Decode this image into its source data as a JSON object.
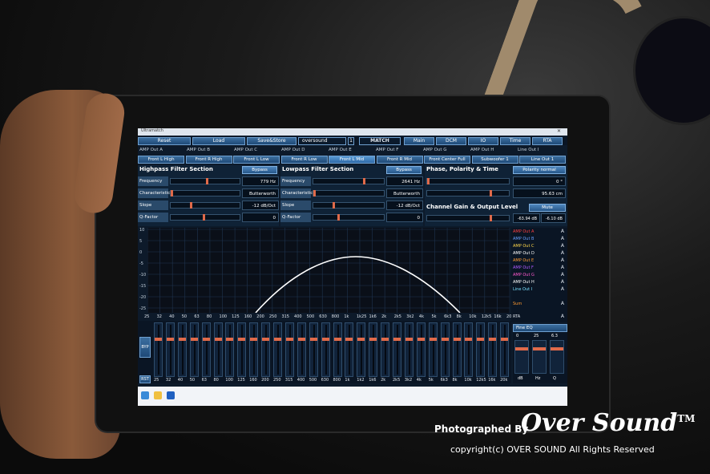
{
  "window": {
    "title": "Ultramatch",
    "close_glyph": "✕"
  },
  "toolbar": {
    "reset": "Reset",
    "load": "Load",
    "save_store": "Save&Store",
    "preset_name": "oversound",
    "preset_index": "1",
    "logo": "MATCH",
    "main": "Main",
    "dcm": "DCM",
    "io": "IO",
    "time": "Time",
    "rta": "RTA"
  },
  "amp_outputs": [
    "AMP Out A",
    "AMP Out B",
    "AMP Out C",
    "AMP Out D",
    "AMP Out E",
    "AMP Out F",
    "AMP Out G",
    "AMP Out H",
    "Line Out I"
  ],
  "channels": [
    "Front L High",
    "Front R High",
    "Front L Low",
    "Front R Low",
    "Front L Mid",
    "Front R Mid",
    "Front Center Full",
    "Subwoofer 1",
    "Line Out 1"
  ],
  "highpass": {
    "title": "Highpass Filter Section",
    "bypass": "Bypass",
    "frequency_label": "Frequency",
    "frequency": "779 Hz",
    "characteristic_label": "Characteristic",
    "characteristic": "Butterworth",
    "slope_label": "Slope",
    "slope": "-12 dB/Oct",
    "qfactor_label": "Q-Factor",
    "qfactor": "0"
  },
  "lowpass": {
    "title": "Lowpass Filter Section",
    "bypass": "Bypass",
    "frequency_label": "Frequency",
    "frequency": "2641 Hz",
    "characteristic_label": "Characteristic",
    "characteristic": "Butterworth",
    "slope_label": "Slope",
    "slope": "-12 dB/Oct",
    "qfactor_label": "Q-Factor",
    "qfactor": "0"
  },
  "phase": {
    "title": "Phase, Polarity & Time",
    "polarity": "Polarity normal",
    "phase_value": "0 °",
    "distance": "95.63 cm"
  },
  "gain": {
    "title": "Channel Gain & Output Level",
    "mute": "Mute",
    "level": "-63.94 dB",
    "gain_value": "-6.10 dB"
  },
  "graph": {
    "y_ticks": [
      "10",
      "5",
      "0",
      "-5",
      "-10",
      "-15",
      "-20",
      "-25"
    ],
    "x_ticks": [
      "25",
      "32",
      "40",
      "50",
      "63",
      "80",
      "100",
      "125",
      "160",
      "200",
      "250",
      "315",
      "400",
      "500",
      "630",
      "800",
      "1k",
      "1k25",
      "1k6",
      "2k",
      "2k5",
      "3k2",
      "4k",
      "5k",
      "6k3",
      "8k",
      "10k",
      "12k5",
      "16k",
      "20k"
    ],
    "curve_color": "#ffffff"
  },
  "output_list": [
    {
      "name": "AMP Out A",
      "color": "#ff4040"
    },
    {
      "name": "AMP Out B",
      "color": "#6aa0ff"
    },
    {
      "name": "AMP Out C",
      "color": "#ffd84a"
    },
    {
      "name": "AMP Out D",
      "color": "#ffffff"
    },
    {
      "name": "AMP Out E",
      "color": "#ff9a30"
    },
    {
      "name": "AMP Out F",
      "color": "#b05aff"
    },
    {
      "name": "AMP Out G",
      "color": "#ff5ad0"
    },
    {
      "name": "AMP Out H",
      "color": "#ffffff"
    },
    {
      "name": "Line Out I",
      "color": "#7ae0ff"
    }
  ],
  "output_list_sum": "Sum",
  "output_list_rta": "RTA",
  "output_list_a": "A",
  "faders": {
    "bypass": "BYP",
    "reset": "RST",
    "bands": [
      "25",
      "32",
      "40",
      "50",
      "63",
      "80",
      "100",
      "125",
      "160",
      "200",
      "250",
      "315",
      "400",
      "500",
      "630",
      "800",
      "1k",
      "1k2",
      "1k6",
      "2k",
      "2k5",
      "3k2",
      "4k",
      "5k",
      "6k3",
      "8k",
      "10k",
      "12k5",
      "16k",
      "20k"
    ]
  },
  "fine_eq": {
    "title": "Fine EQ",
    "values": [
      "0",
      "25",
      "6.3"
    ],
    "labels": [
      "dB",
      "Hz",
      "Q"
    ]
  },
  "watermark": {
    "photographed_by": "Photographed By",
    "brand": "Over Sound",
    "tm": "TM",
    "copyright": "copyright(c) OVER SOUND All Rights Reserved"
  }
}
